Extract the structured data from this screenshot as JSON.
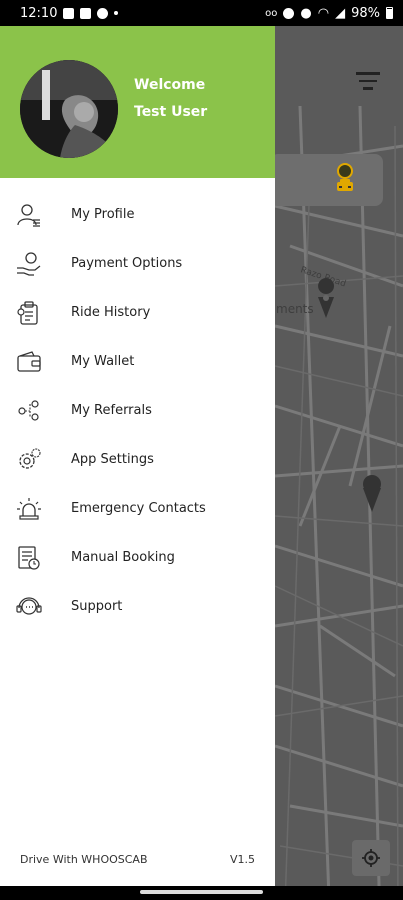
{
  "status_bar": {
    "time": "12:10",
    "battery": "98%"
  },
  "drawer": {
    "header": {
      "welcome_line1": "Welcome",
      "welcome_line2": "Test User",
      "background_color": "#8bc34a"
    },
    "menu": [
      {
        "label": "My Profile",
        "icon": "profile-icon"
      },
      {
        "label": "Payment Options",
        "icon": "payment-hand-icon"
      },
      {
        "label": "Ride History",
        "icon": "ride-history-icon"
      },
      {
        "label": "My Wallet",
        "icon": "wallet-icon"
      },
      {
        "label": "My Referrals",
        "icon": "referrals-icon"
      },
      {
        "label": "App Settings",
        "icon": "gear-icon"
      },
      {
        "label": "Emergency Contacts",
        "icon": "siren-icon"
      },
      {
        "label": "Manual Booking",
        "icon": "manual-booking-icon"
      },
      {
        "label": "Support",
        "icon": "headset-icon"
      }
    ],
    "footer": {
      "brand_text": "Drive With WHOOSCAB",
      "version": "V1.5"
    }
  },
  "map": {
    "street_label": "Razo Road",
    "place_label": "ments"
  }
}
